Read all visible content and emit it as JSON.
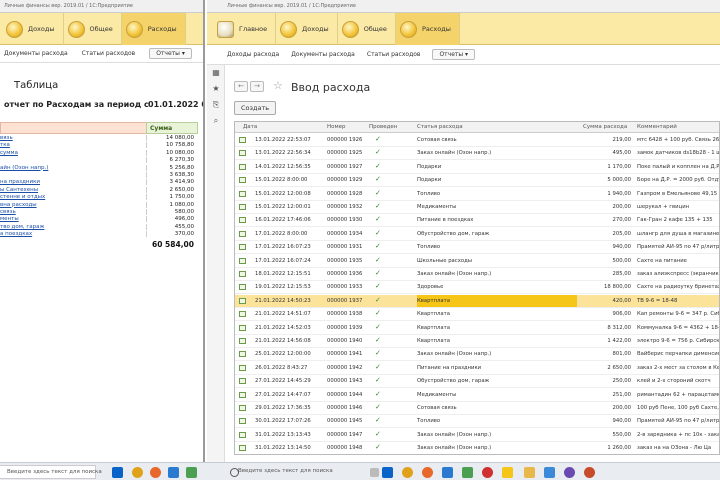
{
  "left_window": {
    "title": "Личные финансы вер. 2019.01 / 1С:Предприятие",
    "sections": [
      "Доходы",
      "Общее",
      "Расходы"
    ],
    "nav": [
      "Документы расхода",
      "Статьи расходов",
      "Отчеты ▾"
    ],
    "report_title": "Таблица",
    "report_subtitle": "отчет по Расходам за период с",
    "report_date": "01.01.2022 0:00:",
    "sum_header": "Сумма",
    "rows": [
      {
        "name": "вязь",
        "value": "14 080,00"
      },
      {
        "name": "тка",
        "value": "10 758,80"
      },
      {
        "name": "сумма",
        "value": "10 080,00"
      },
      {
        "name": "",
        "value": "6 270,30"
      },
      {
        "name": "айн (Озон напр.)",
        "value": "5 256,80"
      },
      {
        "name": "",
        "value": "3 638,30"
      },
      {
        "name": "на праздники",
        "value": "3 414,90"
      },
      {
        "name": "ы Сантехены",
        "value": "2 650,00"
      },
      {
        "name": "стенне и отдых",
        "value": "1 750,00"
      },
      {
        "name": "вна расходы",
        "value": "1 080,00"
      },
      {
        "name": "связь",
        "value": "580,00"
      },
      {
        "name": "менты",
        "value": "496,00"
      },
      {
        "name": "тво дом, гараж",
        "value": "455,00"
      },
      {
        "name": "а поездках",
        "value": "370,00"
      }
    ],
    "total": "60 584,00"
  },
  "right_window": {
    "title": "Личные финансы вер. 2019.01 / 1С:Предприятие",
    "sections": [
      "Главное",
      "Доходы",
      "Общее",
      "Расходы"
    ],
    "nav": [
      "Доходы расхода",
      "Документы расхода",
      "Статьи расходов",
      "Отчеты ▾"
    ],
    "form_title": "Ввод расхода",
    "create_button": "Создать",
    "columns": [
      "Дата",
      "Номер",
      "Проведен",
      "Статья расхода",
      "Сумма расхода",
      "Комментарий"
    ],
    "rows": [
      {
        "date": "13.01.2022 22:53:07",
        "num": "000000 1926",
        "item": "Сотовая связь",
        "sum": "219,00",
        "comment": "мтс 6428 + 100 руб. Связь 267"
      },
      {
        "date": "13.01.2022 22:56:34",
        "num": "000000 1925",
        "item": "Заказ онлайн (Озон напр.)",
        "sum": "495,00",
        "comment": "замок датчиков ds18b28 - 1 шт"
      },
      {
        "date": "14.01.2022 12:56:35",
        "num": "000000 1927",
        "item": "Подарки",
        "sum": "1 170,00",
        "comment": "Поке палый и копплен на Д.Р."
      },
      {
        "date": "15.01.2022 8:00:00",
        "num": "000000 1929",
        "item": "Подарки",
        "sum": "5 000,00",
        "comment": "Боре на Д.Р. = 2000 руб. Отду"
      },
      {
        "date": "15.01.2022 12:00:08",
        "num": "000000 1928",
        "item": "Топливо",
        "sum": "1 940,00",
        "comment": "Газпром в Емельянове 49,15 р"
      },
      {
        "date": "15.01.2022 12:00:01",
        "num": "000000 1932",
        "item": "Медикаменты",
        "sum": "200,00",
        "comment": "шерукал + гвицин"
      },
      {
        "date": "16.01.2022 17:46:06",
        "num": "000000 1930",
        "item": "Питание в поездках",
        "sum": "270,00",
        "comment": "Гак-Гран 2 кафе 135 + 135"
      },
      {
        "date": "17.01.2022 8:00:00",
        "num": "000000 1934",
        "item": "Обустройство дом, гараж",
        "sum": "205,00",
        "comment": "шлангр для душа в магазине с"
      },
      {
        "date": "17.01.2022 16:07:23",
        "num": "000000 1931",
        "item": "Топливо",
        "sum": "940,00",
        "comment": "Прамятей АИ-95 по 47 р/литр 2"
      },
      {
        "date": "17.01.2022 16:07:24",
        "num": "000000 1935",
        "item": "Школьные расходы",
        "sum": "500,00",
        "comment": "Сахте на питание"
      },
      {
        "date": "18.01.2022 12:15:51",
        "num": "000000 1936",
        "item": "Заказ онлайн (Озон напр.)",
        "sum": "285,00",
        "comment": "заказ алиэкспресс (экранчика"
      },
      {
        "date": "19.01.2022 12:15:53",
        "num": "000000 1933",
        "item": "Здоровье",
        "sum": "18 800,00",
        "comment": "Сахте на радиоутку бринетах"
      },
      {
        "date": "21.01.2022 14:50:23",
        "num": "000000 1937",
        "item": "Квартплата",
        "sum": "420,00",
        "comment": "ТВ 9-6 = 18-48"
      },
      {
        "date": "21.01.2022 14:51:07",
        "num": "000000 1938",
        "item": "Квартплата",
        "sum": "906,00",
        "comment": "Кап ремонты 9-6 = 347 р. Сиби"
      },
      {
        "date": "21.01.2022 14:52:03",
        "num": "000000 1939",
        "item": "Квартплата",
        "sum": "8 312,00",
        "comment": "Коммуналка 9-6 = 4362 + 18-4"
      },
      {
        "date": "21.01.2022 14:56:08",
        "num": "000000 1940",
        "item": "Квартплата",
        "sum": "1 422,00",
        "comment": "электро 9-6 = 756 р. Сибирска"
      },
      {
        "date": "25.01.2022 12:00:00",
        "num": "000000 1941",
        "item": "Заказ онлайн (Озон напр.)",
        "sum": "801,00",
        "comment": "Вайберис перчапки дименсион"
      },
      {
        "date": "26.01.2022 8:43:27",
        "num": "000000 1942",
        "item": "Питание на праздники",
        "sum": "2 650,00",
        "comment": "заказ 2-х мест за столом в Ке"
      },
      {
        "date": "27.01.2022 14:45:29",
        "num": "000000 1943",
        "item": "Обустройство дом, гараж",
        "sum": "250,00",
        "comment": "клей и 2-х стороний скотч"
      },
      {
        "date": "27.01.2022 14:47:07",
        "num": "000000 1944",
        "item": "Медикаменты",
        "sum": "251,00",
        "comment": "римантадин 62 + парацетамол"
      },
      {
        "date": "29.01.2022 17:36:35",
        "num": "000000 1946",
        "item": "Сотовая связь",
        "sum": "200,00",
        "comment": "100 руб Пене, 100 руб Сахте,"
      },
      {
        "date": "30.01.2022 17:07:26",
        "num": "000000 1945",
        "item": "Топливо",
        "sum": "940,00",
        "comment": "Прамятей АИ-95 по 47 р/литр 2"
      },
      {
        "date": "31.01.2022 13:13:43",
        "num": "000000 1947",
        "item": "Заказ онлайн (Озон напр.)",
        "sum": "550,00",
        "comment": "2-в зарядника + пс 10к - заказ"
      },
      {
        "date": "31.01.2022 13:14:50",
        "num": "000000 1948",
        "item": "Заказ онлайн (Озон напр.)",
        "sum": "1 260,00",
        "comment": "заказ на на ОЗона - Лю Ца"
      }
    ]
  },
  "taskbar": {
    "left_search": "Введите здесь текст для поиска",
    "right_search": "Введите здесь текст для поиска"
  }
}
